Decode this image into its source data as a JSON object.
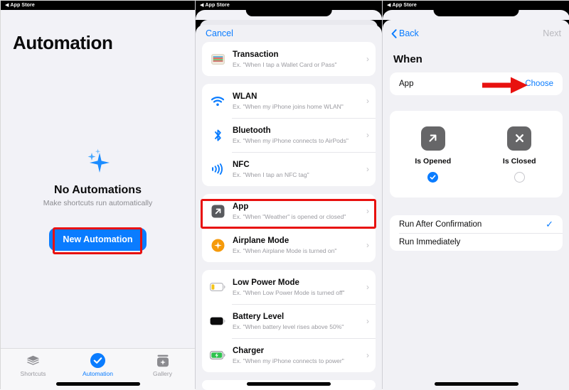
{
  "panels": {
    "left": {
      "statusbar": "App Store",
      "title": "Automation",
      "empty_title": "No Automations",
      "empty_subtitle": "Make shortcuts run automatically",
      "new_automation_label": "New Automation",
      "tabs": [
        {
          "label": "Shortcuts",
          "icon": "stack-icon",
          "active": false
        },
        {
          "label": "Automation",
          "icon": "automation-check-icon",
          "active": true
        },
        {
          "label": "Gallery",
          "icon": "gallery-icon",
          "active": false
        }
      ],
      "sparkle_icon": "sparkles-icon",
      "highlight_color": "#e8110f"
    },
    "middle": {
      "statusbar": "App Store",
      "cancel_label": "Cancel",
      "groups": [
        {
          "rows": [
            {
              "title": "Transaction",
              "subtitle": "Ex. \"When I tap a Wallet Card or Pass\"",
              "icon": "wallet-card-icon"
            }
          ]
        },
        {
          "rows": [
            {
              "title": "WLAN",
              "subtitle": "Ex. \"When my iPhone joins home WLAN\"",
              "icon": "wifi-icon"
            },
            {
              "title": "Bluetooth",
              "subtitle": "Ex. \"When my iPhone connects to AirPods\"",
              "icon": "bluetooth-icon"
            },
            {
              "title": "NFC",
              "subtitle": "Ex. \"When I tap an NFC tag\"",
              "icon": "nfc-icon"
            }
          ]
        },
        {
          "rows": [
            {
              "title": "App",
              "subtitle": "Ex. \"When \"Weather\" is opened or closed\"",
              "icon": "app-arrow-icon",
              "highlighted": true
            },
            {
              "title": "Airplane Mode",
              "subtitle": "Ex. \"When Airplane Mode is turned on\"",
              "icon": "airplane-icon"
            }
          ]
        },
        {
          "rows": [
            {
              "title": "Low Power Mode",
              "subtitle": "Ex. \"When Low Power Mode is turned off\"",
              "icon": "battery-low-icon"
            },
            {
              "title": "Battery Level",
              "subtitle": "Ex. \"When battery level rises above 50%\"",
              "icon": "battery-full-icon"
            },
            {
              "title": "Charger",
              "subtitle": "Ex. \"When my iPhone connects to power\"",
              "icon": "battery-charging-icon"
            }
          ]
        }
      ],
      "chevron": "›"
    },
    "right": {
      "statusbar": "App Store",
      "back_label": "Back",
      "next_label": "Next",
      "section_title": "When",
      "app_row": {
        "label": "App",
        "action": "Choose"
      },
      "states": [
        {
          "label": "Is Opened",
          "icon": "arrow-up-right-icon",
          "selected": true
        },
        {
          "label": "Is Closed",
          "icon": "x-mark-icon",
          "selected": false
        }
      ],
      "run_options": [
        {
          "label": "Run After Confirmation",
          "checked": true
        },
        {
          "label": "Run Immediately",
          "checked": false
        }
      ],
      "arrow_annotation_color": "#e8110f"
    }
  },
  "theme": {
    "accent": "#0a7cff",
    "background": "#f2f2f7",
    "card": "#ffffff",
    "highlight": "#e8110f",
    "muted_text": "#9a9aa0"
  }
}
